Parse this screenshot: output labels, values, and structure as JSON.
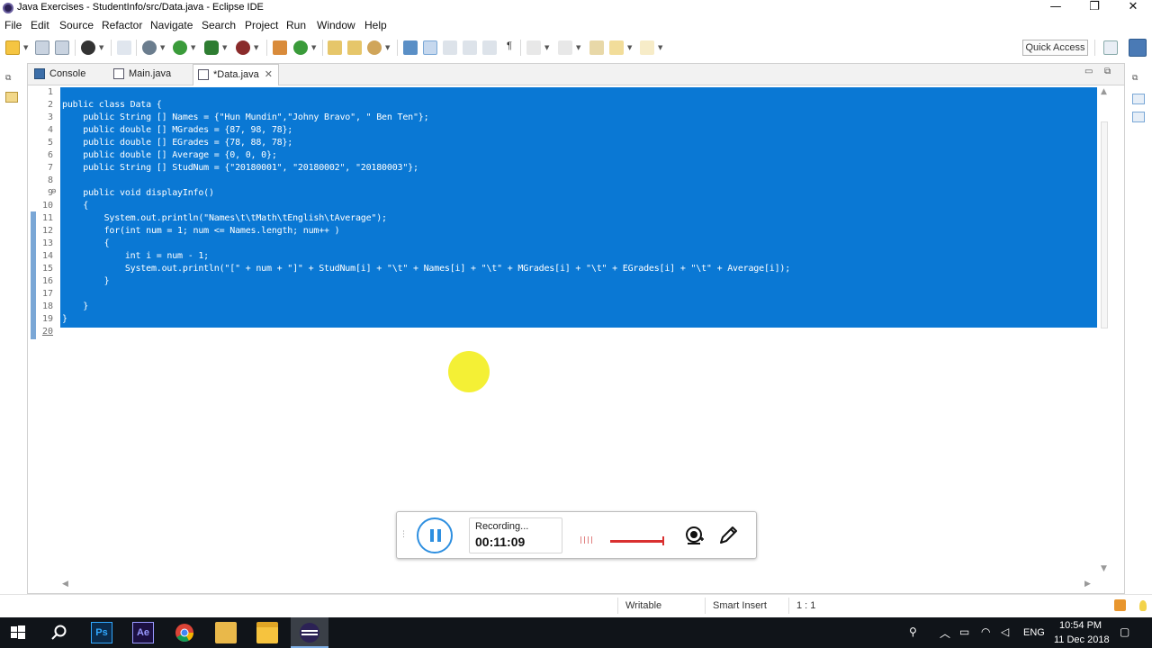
{
  "window": {
    "title": "Java Exercises - StudentInfo/src/Data.java - Eclipse IDE",
    "minimize": "—",
    "restore": "❐",
    "close": "✕"
  },
  "menu": [
    "File",
    "Edit",
    "Source",
    "Refactor",
    "Navigate",
    "Search",
    "Project",
    "Run",
    "Window",
    "Help"
  ],
  "toolbar": {
    "quick_access": "Quick Access"
  },
  "editor": {
    "tabs": [
      {
        "label": "Console",
        "icon": "console-icon",
        "active": false
      },
      {
        "label": "Main.java",
        "icon": "java-file-icon",
        "active": false
      },
      {
        "label": "*Data.java",
        "icon": "java-file-icon",
        "active": true
      }
    ],
    "tab_close": "✕",
    "line_numbers": [
      "1",
      "2",
      "3",
      "4",
      "5",
      "6",
      "7",
      "8",
      "9",
      "10",
      "11",
      "12",
      "13",
      "14",
      "15",
      "16",
      "17",
      "18",
      "19",
      "20"
    ],
    "fold_marker": "⊖",
    "code_lines": [
      "",
      "public class Data {",
      "    public String [] Names = {\"Hun Mundin\",\"Johny Bravo\", \" Ben Ten\"};",
      "    public double [] MGrades = {87, 98, 78};",
      "    public double [] EGrades = {78, 88, 78};",
      "    public double [] Average = {0, 0, 0};",
      "    public String [] StudNum = {\"20180001\", \"20180002\", \"20180003\"};",
      "",
      "    public void displayInfo()",
      "    {",
      "        System.out.println(\"Names\\t\\tMath\\tEnglish\\tAverage\");",
      "        for(int num = 1; num <= Names.length; num++ )",
      "        {",
      "            int i = num - 1;",
      "            System.out.println(\"[\" + num + \"]\" + StudNum[i] + \"\\t\" + Names[i] + \"\\t\" + MGrades[i] + \"\\t\" + EGrades[i] + \"\\t\" + Average[i]);",
      "        }",
      "",
      "    }",
      "}",
      ""
    ],
    "selection_color": "#0a78d4"
  },
  "recorder": {
    "status": "Recording...",
    "time": "00:11:09",
    "pause_icon": "pause-icon",
    "webcam_icon": "webcam-icon",
    "pen_icon": "pen-icon"
  },
  "statusbar": {
    "mode": "Writable",
    "insert": "Smart Insert",
    "position": "1 : 1"
  },
  "taskbar": {
    "language": "ENG",
    "time": "10:54 PM",
    "date": "11 Dec 2018",
    "apps": [
      "start-icon",
      "search-icon",
      "photoshop-icon",
      "after-effects-icon",
      "chrome-icon",
      "explorer-icon",
      "folder-icon",
      "eclipse-icon"
    ]
  }
}
